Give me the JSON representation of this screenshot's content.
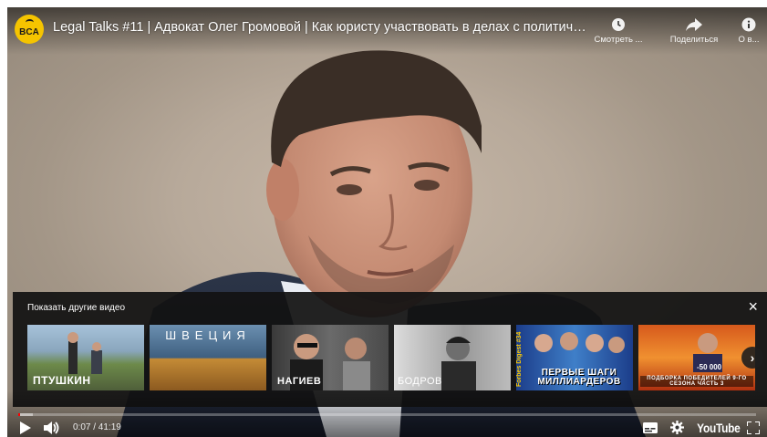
{
  "video": {
    "title": "Legal Talks #11 | Адвокат Олег Громовой | Как юристу участвовать в делах с политическ...",
    "channel_logo_text": "BCA"
  },
  "top_actions": [
    {
      "icon": "clock-icon",
      "label": "Смотреть ..."
    },
    {
      "icon": "share-icon",
      "label": "Поделиться"
    },
    {
      "icon": "info-icon",
      "label": "О в..."
    }
  ],
  "more_videos": {
    "title": "Показать другие видео",
    "close_label": "×",
    "next_label": "›",
    "items": [
      {
        "caption": "ПТУШКИН"
      },
      {
        "caption": "ШВЕЦИЯ"
      },
      {
        "caption": "НАГИЕВ"
      },
      {
        "caption": "БОДРОВ"
      },
      {
        "caption": "ПЕРВЫЕ ШАГИ МИЛЛИАРДЕРОВ",
        "side_text": "Forbes Digest #34"
      },
      {
        "caption": "ПОДБОРКА ПОБЕДИТЕЛЕЙ 9-ГО СЕЗОНА ЧАСТЬ 3",
        "badge": "-50 000"
      }
    ]
  },
  "player": {
    "time_display": "0:07 / 41:19",
    "brand": "YouTube",
    "progress_played": 0.003,
    "progress_loaded": 0.02,
    "accent_color": "#ff0000"
  }
}
